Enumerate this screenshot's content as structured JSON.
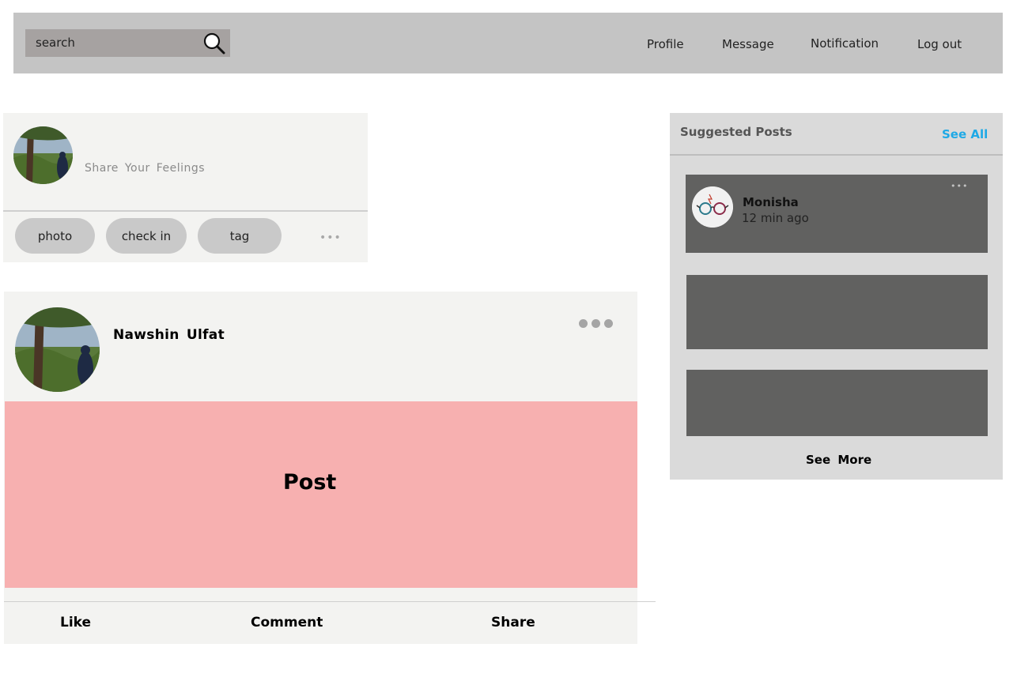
{
  "header": {
    "search": {
      "placeholder": "search",
      "icon": "search-icon"
    },
    "nav": [
      {
        "label": "Profile"
      },
      {
        "label": "Message"
      },
      {
        "label": "Notification"
      },
      {
        "label": "Log out"
      }
    ]
  },
  "composer": {
    "placeholder": "Share Your Feelings",
    "actions": [
      {
        "label": "photo"
      },
      {
        "label": "check in"
      },
      {
        "label": "tag"
      }
    ],
    "more": "•••"
  },
  "post": {
    "author": "Nawshin Ulfat",
    "body_label": "Post",
    "more_icon": "more-dots-icon",
    "actions": [
      {
        "label": "Like"
      },
      {
        "label": "Comment"
      },
      {
        "label": "Share"
      }
    ]
  },
  "suggested": {
    "title": "Suggested Posts",
    "see_all": "See All",
    "items": [
      {
        "name": "Monisha",
        "time": "12 min ago",
        "more": "•••"
      }
    ],
    "see_more": "See More"
  },
  "colors": {
    "topbar": "#c4c4c4",
    "search_bg": "#a6a2a1",
    "card_bg": "#f3f3f1",
    "post_body": "#f7b0b0",
    "sidebar_bg": "#dadada",
    "suggest_item": "#616160",
    "link": "#1ea9e6"
  }
}
